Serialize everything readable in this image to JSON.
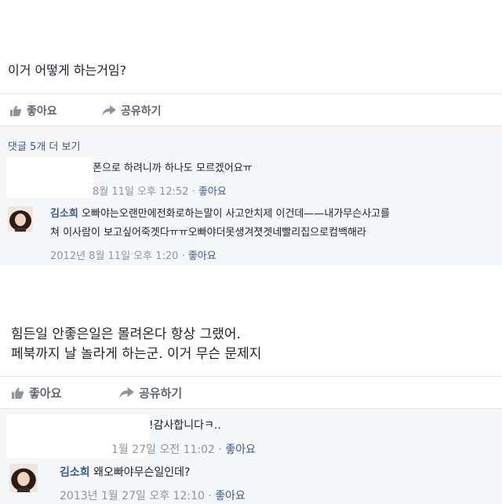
{
  "posts": [
    {
      "text_lines": [
        "이거 어떻게 하는거임?"
      ],
      "actions": {
        "like_label": "좋아요",
        "share_label": "공유하기"
      },
      "more_comments_label": "댓글 5개 더 보기",
      "comments": [
        {
          "name": "",
          "text": "폰으로 하려니까 하나도 모르겠어요ㅠ",
          "date": "8월 11일 오후 12:52",
          "like_label": "좋아요"
        },
        {
          "name": "김소희",
          "text": "오빠야는오랜만에전화로하는말이 사고안치제 이건데——내가무슨사고를",
          "text2": "쳐 이사람이 보고싶어죽겟다ㅠㅠ오빠야더못생겨졋겟네빨리집으로컴백해라",
          "date": "2012년 8월 11일 오후 1:20",
          "like_label": "좋아요"
        }
      ]
    },
    {
      "text_lines": [
        "힘든일 안좋은일은 몰려온다 항상 그랬어.",
        "페북까지 날 놀라게 하는군. 이거 무슨 문제지"
      ],
      "actions": {
        "like_label": "좋아요",
        "share_label": "공유하기"
      },
      "comments": [
        {
          "name": "",
          "text": "!감사합니다ㅋ..",
          "date": "1월 27일 오전 11:02",
          "like_label": "좋아요"
        },
        {
          "name": "김소희",
          "text": "왜오빠야무슨일인데?",
          "date": "2013년 1월 27일 오후 12:10",
          "like_label": "좋아요"
        }
      ]
    }
  ],
  "separator": "·",
  "icons": {
    "like": "thumbs-up-icon",
    "share": "share-arrow-icon"
  },
  "colors": {
    "link": "#385898",
    "meta": "#90949c",
    "text": "#1d2129",
    "panel": "#f6f7f9"
  }
}
